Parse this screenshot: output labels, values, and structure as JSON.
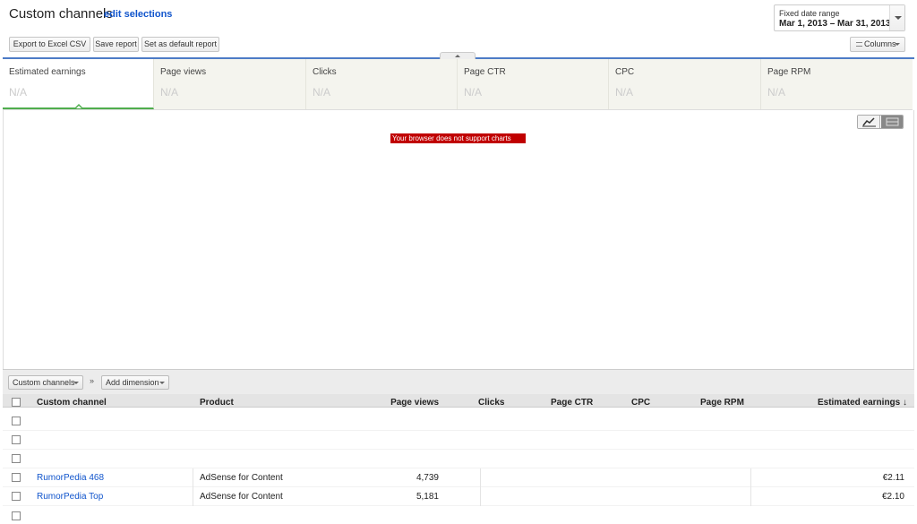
{
  "header": {
    "title": "Custom channels",
    "edit_link": "edit selections"
  },
  "date_range": {
    "label": "Fixed date range",
    "value": "Mar 1, 2013 – Mar 31, 2013"
  },
  "toolbar": {
    "export_label": "Export to Excel CSV",
    "save_label": "Save report",
    "default_label": "Set as default report",
    "columns_label": "Columns"
  },
  "metrics": [
    {
      "name": "Estimated earnings",
      "value": "N/A"
    },
    {
      "name": "Page views",
      "value": "N/A"
    },
    {
      "name": "Clicks",
      "value": "N/A"
    },
    {
      "name": "Page CTR",
      "value": "N/A"
    },
    {
      "name": "CPC",
      "value": "N/A"
    },
    {
      "name": "Page RPM",
      "value": "N/A"
    }
  ],
  "chart": {
    "error": "Your browser does not support charts"
  },
  "dimensions": {
    "selected": "Custom channels",
    "separator": "»",
    "add_label": "Add dimension"
  },
  "table": {
    "columns": {
      "channel": "Custom channel",
      "product": "Product",
      "page_views": "Page views",
      "clicks": "Clicks",
      "page_ctr": "Page CTR",
      "cpc": "CPC",
      "page_rpm": "Page RPM",
      "earnings": "Estimated earnings ↓"
    },
    "rows": [
      {
        "channel": "",
        "product": "",
        "page_views": "",
        "earnings": ""
      },
      {
        "channel": "",
        "product": "",
        "page_views": "",
        "earnings": ""
      },
      {
        "channel": "",
        "product": "",
        "page_views": "",
        "earnings": ""
      },
      {
        "channel": "RumorPedia 468",
        "product": "AdSense for Content",
        "page_views": "4,739",
        "earnings": "€2.11"
      },
      {
        "channel": "RumorPedia Top",
        "product": "AdSense for Content",
        "page_views": "5,181",
        "earnings": "€2.10"
      },
      {
        "channel": "",
        "product": "",
        "page_views": "",
        "earnings": ""
      }
    ]
  },
  "colors": {
    "accent": "#4d7bc6",
    "link": "#1155cc",
    "active_metric": "#4fad4d",
    "error": "#c00000"
  }
}
